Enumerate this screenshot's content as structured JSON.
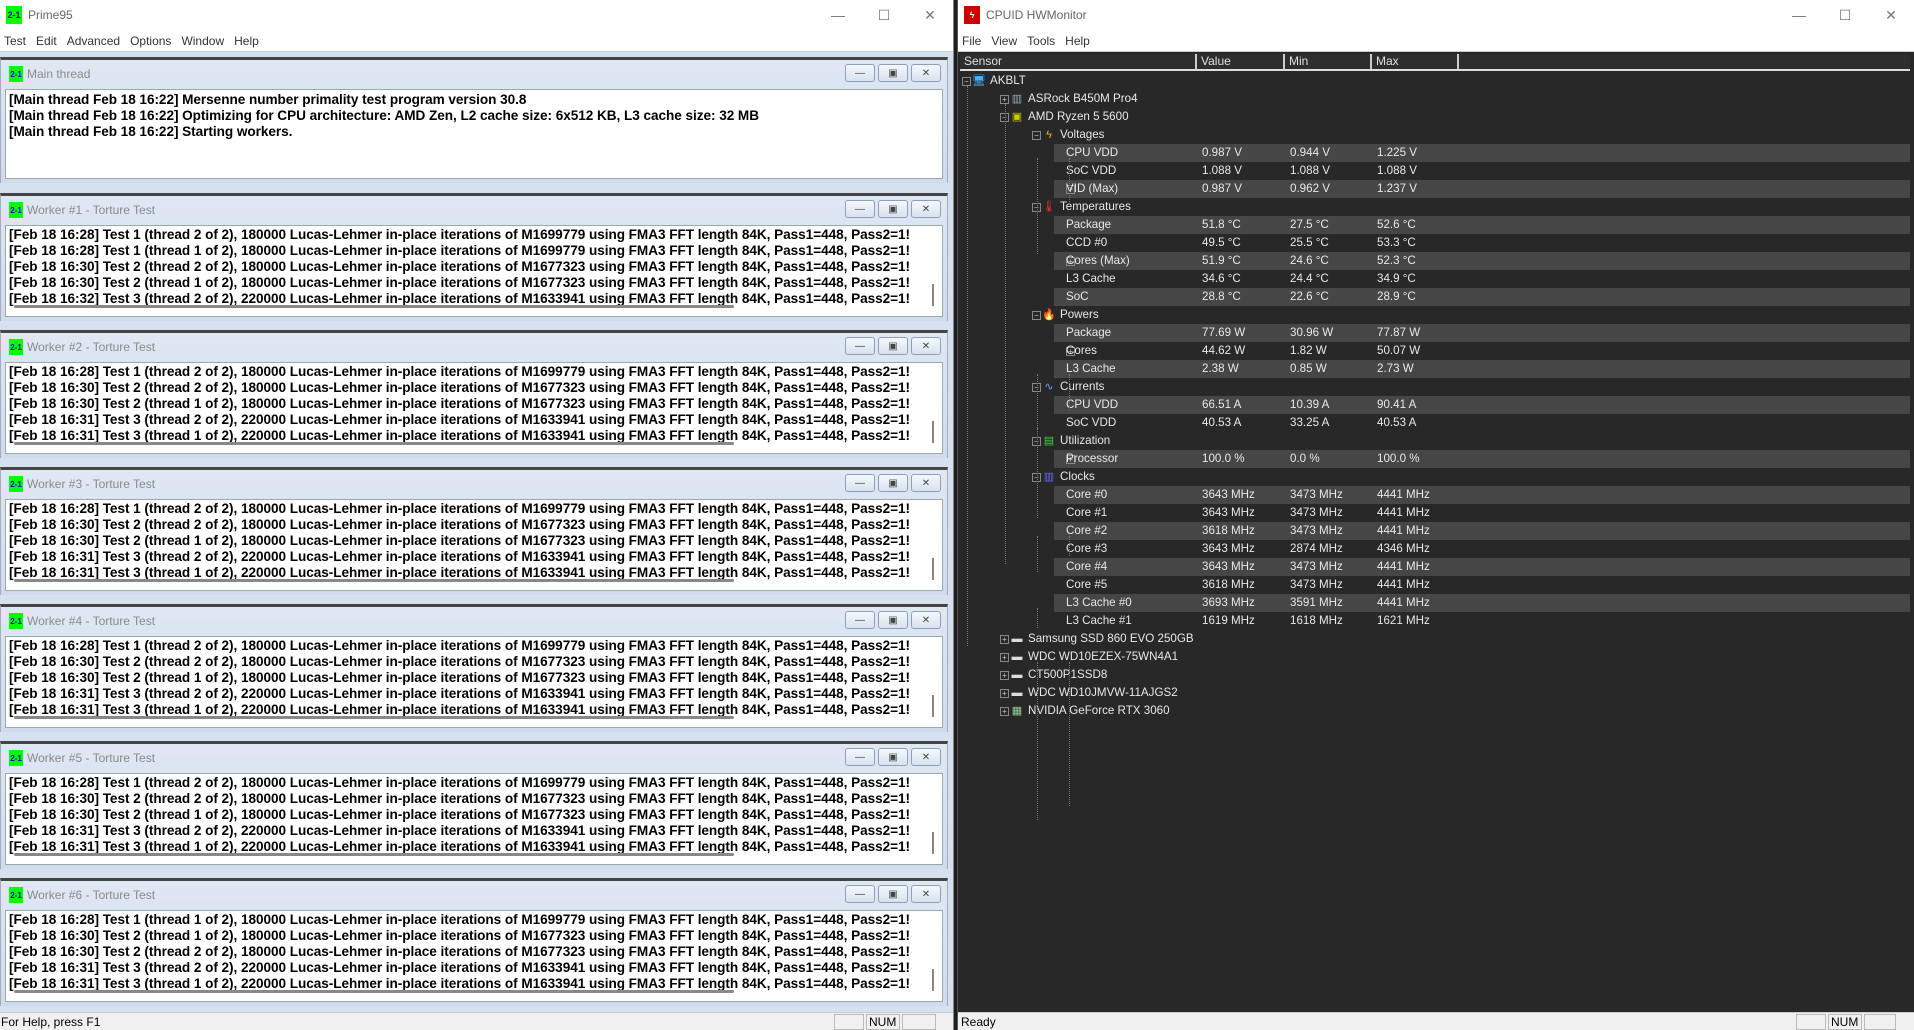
{
  "prime95": {
    "title": "Prime95",
    "icon_text": "2-1",
    "menu": [
      "Test",
      "Edit",
      "Advanced",
      "Options",
      "Window",
      "Help"
    ],
    "caption": [
      "—",
      "☐",
      "✕"
    ],
    "main_thread": {
      "title": "Main thread",
      "lines": [
        "[Main thread Feb 18 16:22] Mersenne number primality test program version 30.8",
        "[Main thread Feb 18 16:22] Optimizing for CPU architecture: AMD Zen, L2 cache size: 6x512 KB, L3 cache size: 32 MB",
        "[Main thread Feb 18 16:22] Starting workers."
      ]
    },
    "workers": [
      {
        "title": "Worker #1 - Torture Test",
        "lines": [
          "[Feb 18 16:28] Test 1 (thread 2 of 2), 180000 Lucas-Lehmer in-place iterations of M1699779 using FMA3 FFT length 84K, Pass1=448, Pass2=1!",
          "[Feb 18 16:28] Test 1 (thread 1 of 2), 180000 Lucas-Lehmer in-place iterations of M1699779 using FMA3 FFT length 84K, Pass1=448, Pass2=1!",
          "[Feb 18 16:30] Test 2 (thread 2 of 2), 180000 Lucas-Lehmer in-place iterations of M1677323 using FMA3 FFT length 84K, Pass1=448, Pass2=1!",
          "[Feb 18 16:30] Test 2 (thread 1 of 2), 180000 Lucas-Lehmer in-place iterations of M1677323 using FMA3 FFT length 84K, Pass1=448, Pass2=1!",
          "[Feb 18 16:32] Test 3 (thread 2 of 2), 220000 Lucas-Lehmer in-place iterations of M1633941 using FMA3 FFT length 84K, Pass1=448, Pass2=1!"
        ]
      },
      {
        "title": "Worker #2 - Torture Test",
        "lines": [
          "[Feb 18 16:28] Test 1 (thread 2 of 2), 180000 Lucas-Lehmer in-place iterations of M1699779 using FMA3 FFT length 84K, Pass1=448, Pass2=1!",
          "[Feb 18 16:30] Test 2 (thread 2 of 2), 180000 Lucas-Lehmer in-place iterations of M1677323 using FMA3 FFT length 84K, Pass1=448, Pass2=1!",
          "[Feb 18 16:30] Test 2 (thread 1 of 2), 180000 Lucas-Lehmer in-place iterations of M1677323 using FMA3 FFT length 84K, Pass1=448, Pass2=1!",
          "[Feb 18 16:31] Test 3 (thread 2 of 2), 220000 Lucas-Lehmer in-place iterations of M1633941 using FMA3 FFT length 84K, Pass1=448, Pass2=1!",
          "[Feb 18 16:31] Test 3 (thread 1 of 2), 220000 Lucas-Lehmer in-place iterations of M1633941 using FMA3 FFT length 84K, Pass1=448, Pass2=1!"
        ]
      },
      {
        "title": "Worker #3 - Torture Test",
        "lines": [
          "[Feb 18 16:28] Test 1 (thread 2 of 2), 180000 Lucas-Lehmer in-place iterations of M1699779 using FMA3 FFT length 84K, Pass1=448, Pass2=1!",
          "[Feb 18 16:30] Test 2 (thread 2 of 2), 180000 Lucas-Lehmer in-place iterations of M1677323 using FMA3 FFT length 84K, Pass1=448, Pass2=1!",
          "[Feb 18 16:30] Test 2 (thread 1 of 2), 180000 Lucas-Lehmer in-place iterations of M1677323 using FMA3 FFT length 84K, Pass1=448, Pass2=1!",
          "[Feb 18 16:31] Test 3 (thread 2 of 2), 220000 Lucas-Lehmer in-place iterations of M1633941 using FMA3 FFT length 84K, Pass1=448, Pass2=1!",
          "[Feb 18 16:31] Test 3 (thread 1 of 2), 220000 Lucas-Lehmer in-place iterations of M1633941 using FMA3 FFT length 84K, Pass1=448, Pass2=1!"
        ]
      },
      {
        "title": "Worker #4 - Torture Test",
        "lines": [
          "[Feb 18 16:28] Test 1 (thread 2 of 2), 180000 Lucas-Lehmer in-place iterations of M1699779 using FMA3 FFT length 84K, Pass1=448, Pass2=1!",
          "[Feb 18 16:30] Test 2 (thread 2 of 2), 180000 Lucas-Lehmer in-place iterations of M1677323 using FMA3 FFT length 84K, Pass1=448, Pass2=1!",
          "[Feb 18 16:30] Test 2 (thread 1 of 2), 180000 Lucas-Lehmer in-place iterations of M1677323 using FMA3 FFT length 84K, Pass1=448, Pass2=1!",
          "[Feb 18 16:31] Test 3 (thread 2 of 2), 220000 Lucas-Lehmer in-place iterations of M1633941 using FMA3 FFT length 84K, Pass1=448, Pass2=1!",
          "[Feb 18 16:31] Test 3 (thread 1 of 2), 220000 Lucas-Lehmer in-place iterations of M1633941 using FMA3 FFT length 84K, Pass1=448, Pass2=1!"
        ]
      },
      {
        "title": "Worker #5 - Torture Test",
        "lines": [
          "[Feb 18 16:28] Test 1 (thread 2 of 2), 180000 Lucas-Lehmer in-place iterations of M1699779 using FMA3 FFT length 84K, Pass1=448, Pass2=1!",
          "[Feb 18 16:30] Test 2 (thread 2 of 2), 180000 Lucas-Lehmer in-place iterations of M1677323 using FMA3 FFT length 84K, Pass1=448, Pass2=1!",
          "[Feb 18 16:30] Test 2 (thread 1 of 2), 180000 Lucas-Lehmer in-place iterations of M1677323 using FMA3 FFT length 84K, Pass1=448, Pass2=1!",
          "[Feb 18 16:31] Test 3 (thread 2 of 2), 220000 Lucas-Lehmer in-place iterations of M1633941 using FMA3 FFT length 84K, Pass1=448, Pass2=1!",
          "[Feb 18 16:31] Test 3 (thread 1 of 2), 220000 Lucas-Lehmer in-place iterations of M1633941 using FMA3 FFT length 84K, Pass1=448, Pass2=1!"
        ]
      },
      {
        "title": "Worker #6 - Torture Test",
        "lines": [
          "[Feb 18 16:28] Test 1 (thread 1 of 2), 180000 Lucas-Lehmer in-place iterations of M1699779 using FMA3 FFT length 84K, Pass1=448, Pass2=1!",
          "[Feb 18 16:30] Test 2 (thread 1 of 2), 180000 Lucas-Lehmer in-place iterations of M1677323 using FMA3 FFT length 84K, Pass1=448, Pass2=1!",
          "[Feb 18 16:30] Test 2 (thread 2 of 2), 180000 Lucas-Lehmer in-place iterations of M1677323 using FMA3 FFT length 84K, Pass1=448, Pass2=1!",
          "[Feb 18 16:31] Test 3 (thread 2 of 2), 220000 Lucas-Lehmer in-place iterations of M1633941 using FMA3 FFT length 84K, Pass1=448, Pass2=1!",
          "[Feb 18 16:31] Test 3 (thread 1 of 2), 220000 Lucas-Lehmer in-place iterations of M1633941 using FMA3 FFT length 84K, Pass1=448, Pass2=1!"
        ]
      }
    ],
    "status": "For Help, press F1",
    "num_indicator": "NUM"
  },
  "hwmonitor": {
    "title": "CPUID HWMonitor",
    "menu": [
      "File",
      "View",
      "Tools",
      "Help"
    ],
    "columns": [
      "Sensor",
      "Value",
      "Min",
      "Max"
    ],
    "tree": [
      {
        "level": 0,
        "label": "AKBLT",
        "icon": "computer-icon",
        "exp": "-"
      },
      {
        "level": 1,
        "label": "ASRock B450M Pro4",
        "icon": "motherboard-icon",
        "exp": "+"
      },
      {
        "level": 1,
        "label": "AMD Ryzen 5 5600",
        "icon": "cpu-icon",
        "exp": "-"
      },
      {
        "level": 2,
        "label": "Voltages",
        "icon": "voltage-icon",
        "exp": "-"
      },
      {
        "level": 3,
        "label": "CPU VDD",
        "value": "0.987 V",
        "min": "0.944 V",
        "max": "1.225 V"
      },
      {
        "level": 3,
        "label": "SoC VDD",
        "value": "1.088 V",
        "min": "1.088 V",
        "max": "1.088 V"
      },
      {
        "level": 3,
        "label": "VID (Max)",
        "value": "0.987 V",
        "min": "0.962 V",
        "max": "1.237 V",
        "exp": "+"
      },
      {
        "level": 2,
        "label": "Temperatures",
        "icon": "thermometer-icon",
        "exp": "-"
      },
      {
        "level": 3,
        "label": "Package",
        "value": "51.8 °C",
        "min": "27.5 °C",
        "max": "52.6 °C"
      },
      {
        "level": 3,
        "label": "CCD #0",
        "value": "49.5 °C",
        "min": "25.5 °C",
        "max": "53.3 °C"
      },
      {
        "level": 3,
        "label": "Cores (Max)",
        "value": "51.9 °C",
        "min": "24.6 °C",
        "max": "52.3 °C",
        "exp": "+"
      },
      {
        "level": 3,
        "label": "L3 Cache",
        "value": "34.6 °C",
        "min": "24.4 °C",
        "max": "34.9 °C"
      },
      {
        "level": 3,
        "label": "SoC",
        "value": "28.8 °C",
        "min": "22.6 °C",
        "max": "28.9 °C"
      },
      {
        "level": 2,
        "label": "Powers",
        "icon": "flame-icon",
        "exp": "-"
      },
      {
        "level": 3,
        "label": "Package",
        "value": "77.69 W",
        "min": "30.96 W",
        "max": "77.87 W"
      },
      {
        "level": 3,
        "label": "Cores",
        "value": "44.62 W",
        "min": "1.82 W",
        "max": "50.07 W",
        "exp": "+"
      },
      {
        "level": 3,
        "label": "L3 Cache",
        "value": "2.38 W",
        "min": "0.85 W",
        "max": "2.73 W"
      },
      {
        "level": 2,
        "label": "Currents",
        "icon": "current-icon",
        "exp": "-"
      },
      {
        "level": 3,
        "label": "CPU VDD",
        "value": "66.51 A",
        "min": "10.39 A",
        "max": "90.41 A"
      },
      {
        "level": 3,
        "label": "SoC VDD",
        "value": "40.53 A",
        "min": "33.25 A",
        "max": "40.53 A"
      },
      {
        "level": 2,
        "label": "Utilization",
        "icon": "utilization-icon",
        "exp": "-"
      },
      {
        "level": 3,
        "label": "Processor",
        "value": "100.0 %",
        "min": "0.0 %",
        "max": "100.0 %",
        "exp": "+"
      },
      {
        "level": 2,
        "label": "Clocks",
        "icon": "clock-icon",
        "exp": "-"
      },
      {
        "level": 3,
        "label": "Core #0",
        "value": "3643 MHz",
        "min": "3473 MHz",
        "max": "4441 MHz"
      },
      {
        "level": 3,
        "label": "Core #1",
        "value": "3643 MHz",
        "min": "3473 MHz",
        "max": "4441 MHz"
      },
      {
        "level": 3,
        "label": "Core #2",
        "value": "3618 MHz",
        "min": "3473 MHz",
        "max": "4441 MHz"
      },
      {
        "level": 3,
        "label": "Core #3",
        "value": "3643 MHz",
        "min": "2874 MHz",
        "max": "4346 MHz"
      },
      {
        "level": 3,
        "label": "Core #4",
        "value": "3643 MHz",
        "min": "3473 MHz",
        "max": "4441 MHz"
      },
      {
        "level": 3,
        "label": "Core #5",
        "value": "3618 MHz",
        "min": "3473 MHz",
        "max": "4441 MHz"
      },
      {
        "level": 3,
        "label": "L3 Cache #0",
        "value": "3693 MHz",
        "min": "3591 MHz",
        "max": "4441 MHz"
      },
      {
        "level": 3,
        "label": "L3 Cache #1",
        "value": "1619 MHz",
        "min": "1618 MHz",
        "max": "1621 MHz"
      },
      {
        "level": 1,
        "label": "Samsung SSD 860 EVO 250GB",
        "icon": "drive-icon",
        "exp": "+"
      },
      {
        "level": 1,
        "label": "WDC WD10EZEX-75WN4A1",
        "icon": "drive-icon",
        "exp": "+"
      },
      {
        "level": 1,
        "label": "CT500P1SSD8",
        "icon": "drive-icon",
        "exp": "+"
      },
      {
        "level": 1,
        "label": "WDC WD10JMVW-11AJGS2",
        "icon": "drive-icon",
        "exp": "+"
      },
      {
        "level": 1,
        "label": "NVIDIA GeForce RTX 3060",
        "icon": "gpu-icon",
        "exp": "+"
      }
    ],
    "status": "Ready",
    "num_indicator": "NUM"
  }
}
